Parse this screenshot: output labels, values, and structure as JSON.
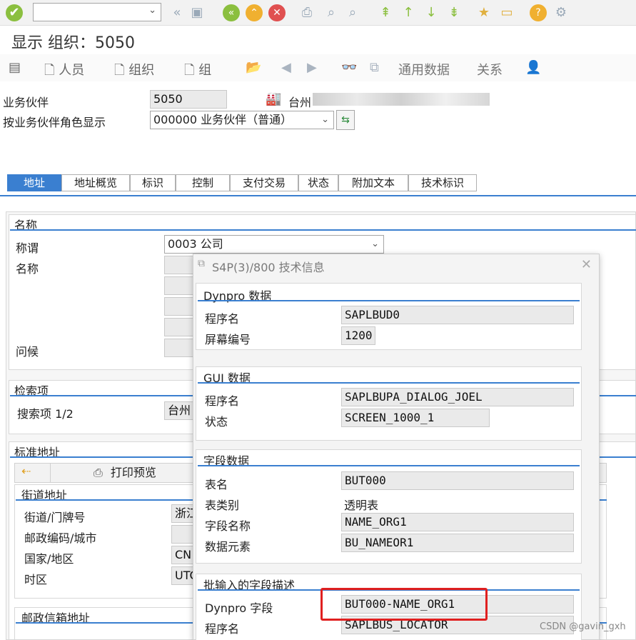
{
  "toolbar": {
    "command_field": "",
    "icons": [
      "enter-icon",
      "back-icon",
      "save-icon",
      "green-back-icon",
      "exit-icon",
      "cancel-icon",
      "print-icon",
      "find-icon",
      "find-next-icon",
      "first-page-icon",
      "prev-page-icon",
      "next-page-icon",
      "last-page-icon",
      "create-session-icon",
      "shortcut-icon",
      "help-icon",
      "settings-icon"
    ]
  },
  "title": "显示 组织：5050",
  "app_toolbar": {
    "person": "人员",
    "organization": "组织",
    "group": "组",
    "general_data": "通用数据",
    "relations": "关系"
  },
  "header": {
    "bp_label": "业务伙伴",
    "bp_value": "5050",
    "bp_name": "台州",
    "role_label": "按业务伙伴角色显示",
    "role_value": "000000 业务伙伴（普通）"
  },
  "tabs": [
    "地址",
    "地址概览",
    "标识",
    "控制",
    "支付交易",
    "状态",
    "附加文本",
    "技术标识"
  ],
  "name_section": {
    "title": "名称",
    "salutation_label": "称谓",
    "salutation_value": "0003 公司",
    "name_label": "名称",
    "greeting_label": "问候"
  },
  "search_section": {
    "title": "检索项",
    "search1_label": "搜索项 1/2",
    "search1_value": "台州"
  },
  "address_section": {
    "title": "标准地址",
    "print_preview": "打印预览",
    "street_title": "街道地址",
    "street_label": "街道/门牌号",
    "street_value": "浙江",
    "postal_label": "邮政编码/城市",
    "country_label": "国家/地区",
    "country_value": "CN",
    "timezone_label": "时区",
    "timezone_value": "UTC",
    "pobox_title": "邮政信箱地址"
  },
  "dialog": {
    "title": "S4P(3)/800 技术信息",
    "dynpro_title": "Dynpro 数据",
    "program_label": "程序名",
    "program_value": "SAPLBUD0",
    "screen_label": "屏幕编号",
    "screen_value": "1200",
    "gui_title": "GUI 数据",
    "gui_program_label": "程序名",
    "gui_program_value": "SAPLBUPA_DIALOG_JOEL",
    "status_label": "状态",
    "status_value": "SCREEN_1000_1",
    "field_title": "字段数据",
    "table_label": "表名",
    "table_value": "BUT000",
    "table_type_label": "表类别",
    "table_type_value": "透明表",
    "field_name_label": "字段名称",
    "field_name_value": "NAME_ORG1",
    "data_element_label": "数据元素",
    "data_element_value": "BU_NAMEOR1",
    "batch_title": "批输入的字段描述",
    "dynpro_field_label": "Dynpro 字段",
    "dynpro_field_value": "BUT000-NAME_ORG1",
    "batch_program_label": "程序名",
    "batch_program_value": "SAPLBUS_LOCATOR"
  },
  "watermark": "CSDN @gavin_gxh",
  "colors": {
    "accent": "#3a7fd0",
    "highlight": "#e02020"
  }
}
